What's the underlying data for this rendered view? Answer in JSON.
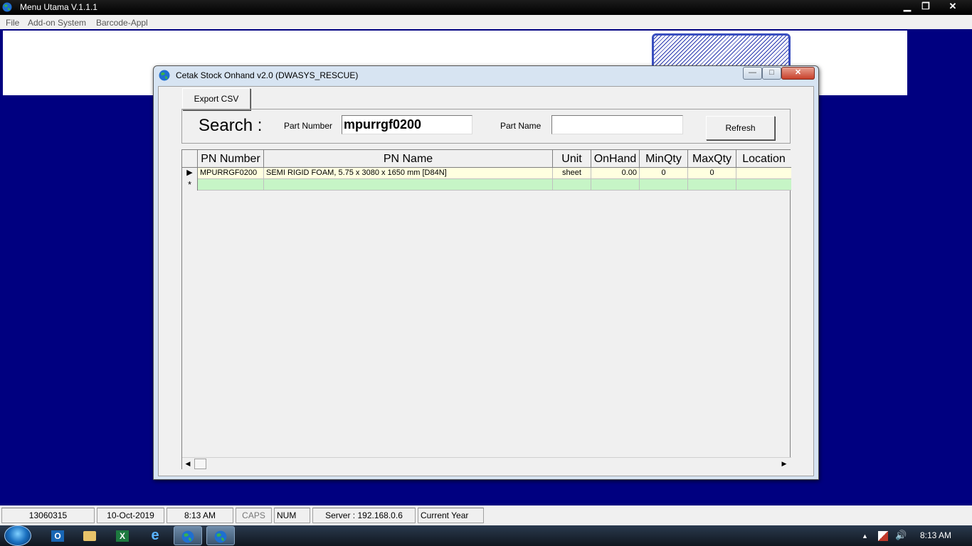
{
  "main_window": {
    "title": "Menu Utama V.1.1.1",
    "minimize_glyph": "▁",
    "restore_glyph": "❐",
    "close_glyph": "✕"
  },
  "menu": [
    "File",
    "Add-on System",
    "Barcode-Appl"
  ],
  "dialog": {
    "title": "Cetak Stock Onhand v2.0 (DWASYS_RESCUE)",
    "minimize_glyph": "—",
    "maximize_glyph": "□",
    "close_glyph": "✕",
    "export_button": "Export CSV",
    "search_label": "Search :",
    "part_number_label": "Part Number",
    "part_number_value": "mpurrgf0200",
    "part_name_label": "Part Name",
    "part_name_value": "",
    "refresh_button": "Refresh"
  },
  "grid": {
    "columns": [
      "PN Number",
      "PN Name",
      "Unit",
      "OnHand",
      "MinQty",
      "MaxQty",
      "Location"
    ],
    "rows": [
      {
        "indicator": "▶",
        "pn_number": "MPURRGF0200",
        "pn_name": "SEMI RIGID FOAM, 5.75 x 3080 x 1650 mm [D84N]",
        "unit": "sheet",
        "onhand": "0.00",
        "minqty": "0",
        "maxqty": "0",
        "location": ""
      }
    ],
    "new_row_indicator": "*",
    "scroll_left": "◀",
    "scroll_right": "▶"
  },
  "status": {
    "user_id": "13060315",
    "date": "10-Oct-2019",
    "time": "8:13 AM",
    "caps": "CAPS",
    "num": "NUM",
    "server": "Server : 192.168.0.6",
    "period": "Current Year"
  },
  "taskbar": {
    "items": [
      "outlook-icon",
      "folder-icon",
      "excel-icon",
      "ie-icon",
      "app-globe-icon",
      "app-globe-icon"
    ],
    "outlook_glyph": "O",
    "excel_glyph": "X",
    "ie_glyph": "e",
    "tray_arrow": "▲",
    "clock": "8:13 AM"
  },
  "colors": {
    "desktop_bg": "#000080",
    "selected_row": "#ffffe0",
    "new_row": "#c6f5c6"
  }
}
